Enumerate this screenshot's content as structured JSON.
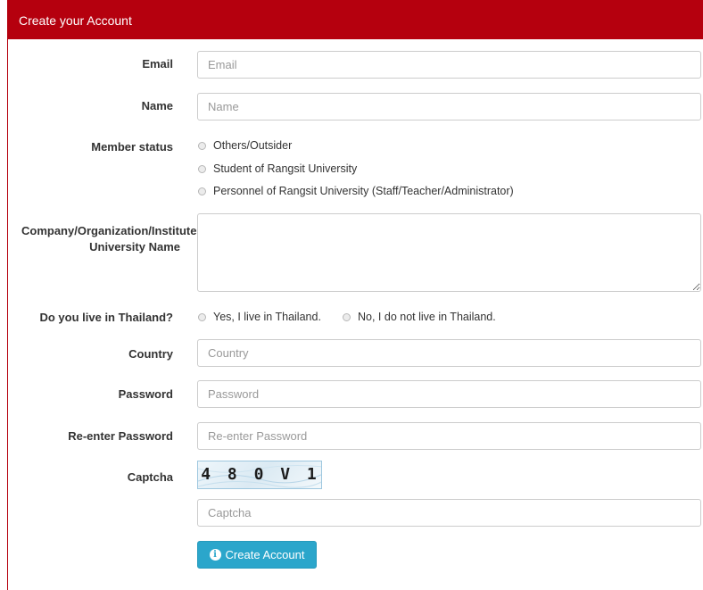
{
  "panel": {
    "title": "Create your Account"
  },
  "fields": {
    "email": {
      "label": "Email",
      "placeholder": "Email"
    },
    "name": {
      "label": "Name",
      "placeholder": "Name"
    },
    "member_status": {
      "label": "Member status",
      "options": [
        "Others/Outsider",
        "Student of Rangsit University",
        "Personnel of Rangsit University (Staff/Teacher/Administrator)"
      ]
    },
    "organization": {
      "label_line1": "Company/Organization/Institute",
      "label_line2": "University Name"
    },
    "live_in_thailand": {
      "label": "Do you live in Thailand?",
      "options": [
        "Yes, I live in Thailand.",
        "No, I do not live in Thailand."
      ]
    },
    "country": {
      "label": "Country",
      "placeholder": "Country"
    },
    "password": {
      "label": "Password",
      "placeholder": "Password"
    },
    "reenter_password": {
      "label": "Re-enter Password",
      "placeholder": "Re-enter Password"
    },
    "captcha": {
      "label": "Captcha",
      "image_text": "4 8 0 V 1",
      "placeholder": "Captcha"
    }
  },
  "submit": {
    "label": "Create Account",
    "icon": "info-circle-icon"
  },
  "colors": {
    "header": "#b5000e",
    "button": "#2ba6cb"
  }
}
